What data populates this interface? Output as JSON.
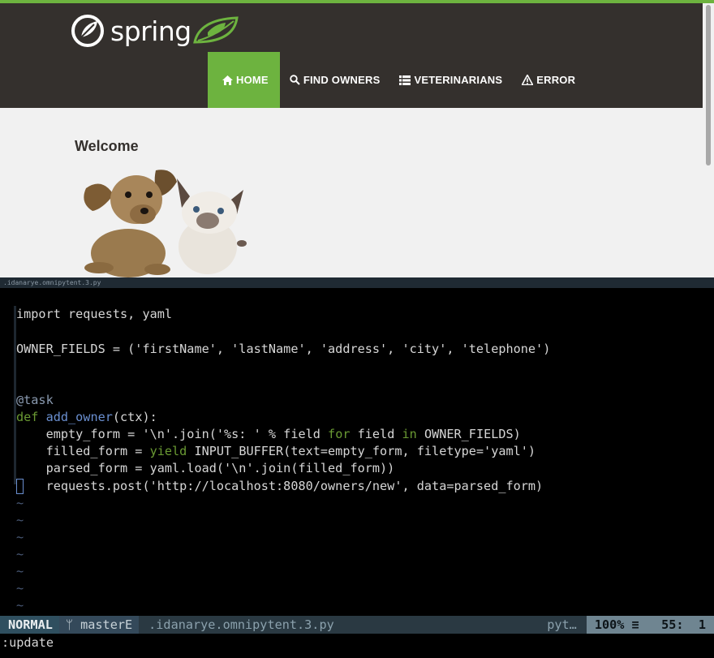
{
  "browser": {
    "brand": "spring",
    "nav": [
      {
        "label": "HOME",
        "icon": "home-icon",
        "active": true
      },
      {
        "label": "FIND OWNERS",
        "icon": "search-icon",
        "active": false
      },
      {
        "label": "VETERINARIANS",
        "icon": "list-icon",
        "active": false
      },
      {
        "label": "ERROR",
        "icon": "warning-icon",
        "active": false
      }
    ],
    "heading": "Welcome",
    "colors": {
      "brand_green": "#6db33f",
      "navbar": "#34302d"
    }
  },
  "tmux": {
    "pane_title": ".idanarye.omnipytent.3.py"
  },
  "editor": {
    "lines": {
      "l1": "import requests, yaml",
      "l3": "OWNER_FIELDS = ('firstName', 'lastName', 'address', 'city', 'telephone')",
      "l6": "@task",
      "l7_kw": "def",
      "l7_fn": "add_owner",
      "l7_rest": "(ctx):",
      "l8_a": "    empty_form = '\\n'.join('%s: ' % field ",
      "l8_for": "for",
      "l8_b": " field ",
      "l8_in": "in",
      "l8_c": " OWNER_FIELDS)",
      "l9_a": "    filled_form = ",
      "l9_yield": "yield",
      "l9_b": " INPUT_BUFFER(text=empty_form, filetype='yaml')",
      "l10": "    parsed_form = yaml.load('\\n'.join(filled_form))",
      "l11": "    requests.post('http://localhost:8080/owners/new', data=parsed_form)"
    },
    "tilde": "~"
  },
  "statusline": {
    "mode": "NORMAL",
    "branch": "ᛘ masterE",
    "filename": ".idanarye.omnipytent.3.py",
    "filetype": "pyt…",
    "percent": "100% ≡",
    "position": "55:  1"
  },
  "cmdline": ":update"
}
